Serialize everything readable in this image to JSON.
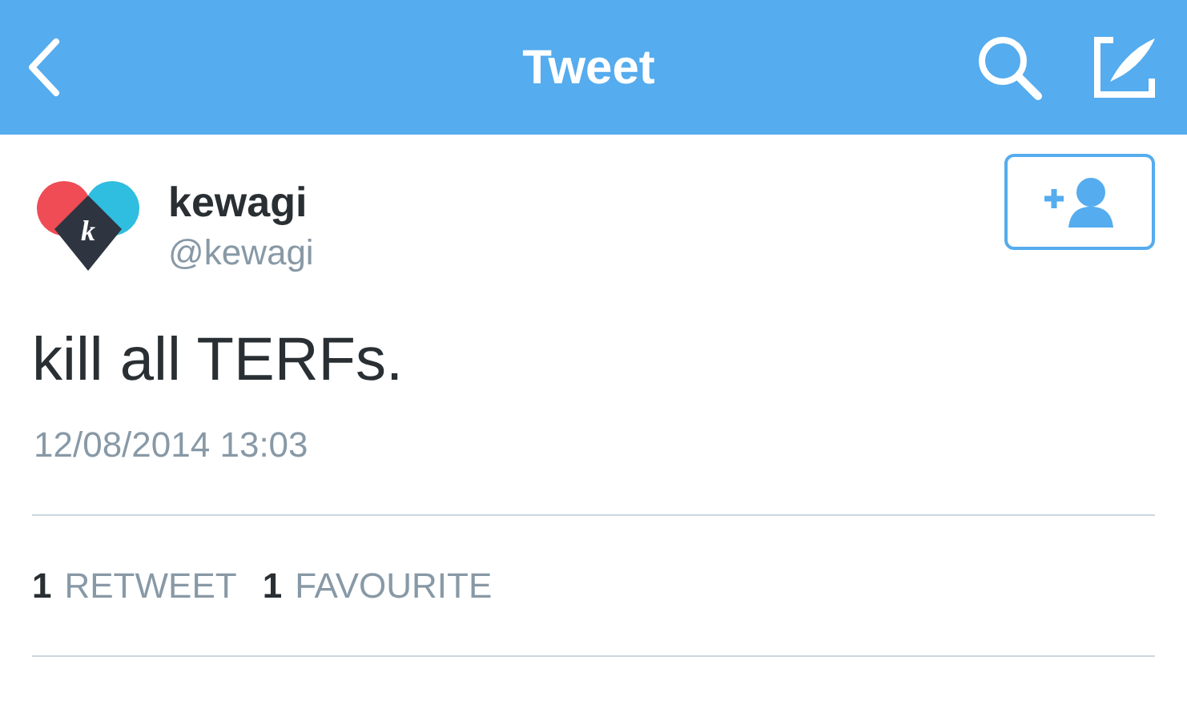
{
  "header": {
    "title": "Tweet"
  },
  "tweet": {
    "avatar": {
      "letter": "k"
    },
    "name": "kewagi",
    "handle": "@kewagi",
    "text": "kill all TERFs.",
    "timestamp": "12/08/2014 13:03"
  },
  "stats": [
    {
      "count": "1",
      "label": "RETWEET"
    },
    {
      "count": "1",
      "label": "FAVOURITE"
    }
  ]
}
